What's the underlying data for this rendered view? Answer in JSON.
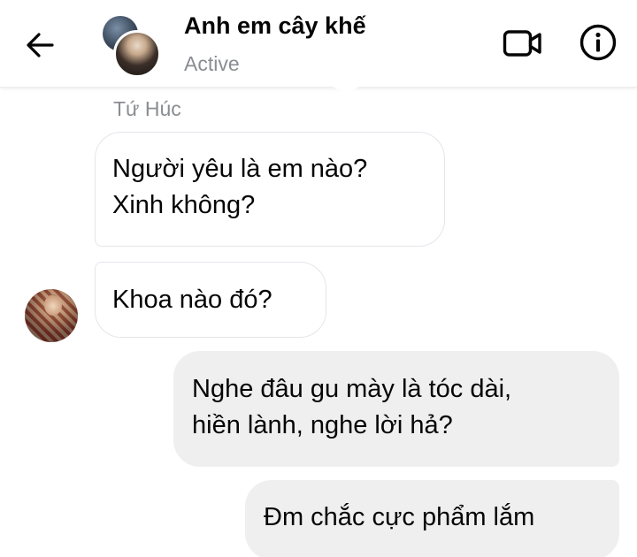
{
  "header": {
    "back_icon": "arrow-left-icon",
    "title": "Anh em cây khế",
    "status": "Active",
    "video_icon": "video-camera-icon",
    "info_icon": "info-icon"
  },
  "conversation": {
    "sender_name": "Tứ Húc",
    "messages": [
      {
        "direction": "incoming",
        "lines": [
          "Người yêu là em nào?",
          "Xinh không?"
        ]
      },
      {
        "direction": "incoming",
        "lines": [
          "Khoa nào đó?"
        ]
      },
      {
        "direction": "outgoing",
        "lines": [
          "Nghe đâu gu mày là tóc dài,",
          "hiền lành, nghe lời hả?"
        ]
      },
      {
        "direction": "outgoing",
        "lines": [
          "Đm chắc cực phẩm lắm"
        ]
      }
    ]
  },
  "colors": {
    "text_primary": "#050505",
    "text_secondary": "#8a8d91",
    "outgoing_bubble": "#efefef",
    "incoming_bubble_border": "#e4e6eb",
    "background": "#ffffff"
  }
}
